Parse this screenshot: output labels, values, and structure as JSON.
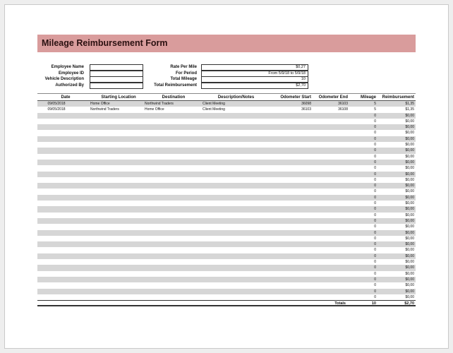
{
  "form": {
    "title": "Mileage Reimbursement Form"
  },
  "left_fields": [
    {
      "label": "Employee Name",
      "value": ""
    },
    {
      "label": "Employee ID",
      "value": ""
    },
    {
      "label": "Vehicle Description",
      "value": ""
    },
    {
      "label": "Authorized By",
      "value": ""
    }
  ],
  "right_fields": [
    {
      "label": "Rate Per Mile",
      "value": "$0,27"
    },
    {
      "label": "For Period",
      "value": "From 5/9/18 to 5/9/18"
    },
    {
      "label": "Total Mileage",
      "value": "10"
    },
    {
      "label": "Total Reimbursement",
      "value": "$2,70"
    }
  ],
  "table": {
    "columns": [
      "Date",
      "Starting Location",
      "Destination",
      "Description/Notes",
      "Odometer Start",
      "Odometer End",
      "Mileage",
      "Reimbursement"
    ],
    "rows": [
      [
        "09/05/2018",
        "Home Office",
        "Northwind Traders",
        "Client Meeting",
        "36098",
        "36103",
        "5",
        "$1,35"
      ],
      [
        "09/05/2018",
        "Northwind Traders",
        "Home Office",
        "Client Meeting",
        "36103",
        "36108",
        "5",
        "$1,35"
      ],
      [
        "",
        "",
        "",
        "",
        "",
        "",
        "0",
        "$0,00"
      ],
      [
        "",
        "",
        "",
        "",
        "",
        "",
        "0",
        "$0,00"
      ],
      [
        "",
        "",
        "",
        "",
        "",
        "",
        "0",
        "$0,00"
      ],
      [
        "",
        "",
        "",
        "",
        "",
        "",
        "0",
        "$0,00"
      ],
      [
        "",
        "",
        "",
        "",
        "",
        "",
        "0",
        "$0,00"
      ],
      [
        "",
        "",
        "",
        "",
        "",
        "",
        "0",
        "$0,00"
      ],
      [
        "",
        "",
        "",
        "",
        "",
        "",
        "0",
        "$0,00"
      ],
      [
        "",
        "",
        "",
        "",
        "",
        "",
        "0",
        "$0,00"
      ],
      [
        "",
        "",
        "",
        "",
        "",
        "",
        "0",
        "$0,00"
      ],
      [
        "",
        "",
        "",
        "",
        "",
        "",
        "0",
        "$0,00"
      ],
      [
        "",
        "",
        "",
        "",
        "",
        "",
        "0",
        "$0,00"
      ],
      [
        "",
        "",
        "",
        "",
        "",
        "",
        "0",
        "$0,00"
      ],
      [
        "",
        "",
        "",
        "",
        "",
        "",
        "0",
        "$0,00"
      ],
      [
        "",
        "",
        "",
        "",
        "",
        "",
        "0",
        "$0,00"
      ],
      [
        "",
        "",
        "",
        "",
        "",
        "",
        "0",
        "$0,00"
      ],
      [
        "",
        "",
        "",
        "",
        "",
        "",
        "0",
        "$0,00"
      ],
      [
        "",
        "",
        "",
        "",
        "",
        "",
        "0",
        "$0,00"
      ],
      [
        "",
        "",
        "",
        "",
        "",
        "",
        "0",
        "$0,00"
      ],
      [
        "",
        "",
        "",
        "",
        "",
        "",
        "0",
        "$0,00"
      ],
      [
        "",
        "",
        "",
        "",
        "",
        "",
        "0",
        "$0,00"
      ],
      [
        "",
        "",
        "",
        "",
        "",
        "",
        "0",
        "$0,00"
      ],
      [
        "",
        "",
        "",
        "",
        "",
        "",
        "0",
        "$0,00"
      ],
      [
        "",
        "",
        "",
        "",
        "",
        "",
        "0",
        "$0,00"
      ],
      [
        "",
        "",
        "",
        "",
        "",
        "",
        "0",
        "$0,00"
      ],
      [
        "",
        "",
        "",
        "",
        "",
        "",
        "0",
        "$0,00"
      ],
      [
        "",
        "",
        "",
        "",
        "",
        "",
        "0",
        "$0,00"
      ],
      [
        "",
        "",
        "",
        "",
        "",
        "",
        "0",
        "$0,00"
      ],
      [
        "",
        "",
        "",
        "",
        "",
        "",
        "0",
        "$0,00"
      ],
      [
        "",
        "",
        "",
        "",
        "",
        "",
        "0",
        "$0,00"
      ],
      [
        "",
        "",
        "",
        "",
        "",
        "",
        "0",
        "$0,00"
      ],
      [
        "",
        "",
        "",
        "",
        "",
        "",
        "0",
        "$0,00"
      ],
      [
        "",
        "",
        "",
        "",
        "",
        "",
        "0",
        "$0,00"
      ]
    ],
    "totals": {
      "label": "Totals",
      "mileage": "10",
      "reimbursement": "$2,70"
    }
  },
  "colors": {
    "title_band": "#d99c9c",
    "row_shade": "#d6d6d6"
  }
}
